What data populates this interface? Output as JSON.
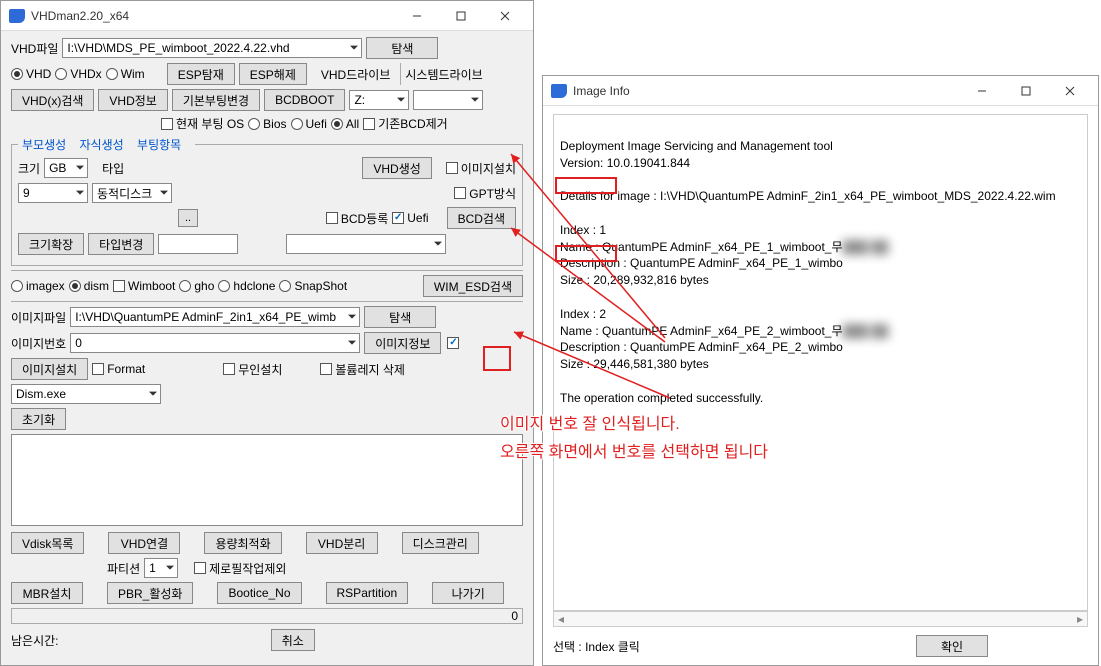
{
  "main": {
    "title": "VHDman2.20_x64",
    "vhd_file_lbl": "VHD파일",
    "vhd_file_path": "I:\\VHD\\MDS_PE_wimboot_2022.4.22.vhd",
    "browse": "탐색",
    "fmt": {
      "vhd": "VHD",
      "vhdx": "VHDx",
      "wim": "Wim"
    },
    "esp_search": "ESP탐재",
    "esp_release": "ESP해제",
    "vhd_drive": "VHD드라이브",
    "sys_drive": "시스템드라이브",
    "vhdx_search": "VHD(x)검색",
    "vhd_info": "VHD정보",
    "basic_boot_change": "기본부팅변경",
    "bcdboot": "BCDBOOT",
    "drive_letter": "Z:",
    "current_boot_os": "현재 부팅 OS",
    "bios": "Bios",
    "uefi": "Uefi",
    "all": "All",
    "remove_existing_bcd": "기존BCD제거",
    "fieldset": {
      "parent": "부모생성",
      "child": "자식생성",
      "boot_items": "부팅항목",
      "size_lbl": "크기",
      "size_unit": "GB",
      "size_val": "9",
      "type_lbl": "타입",
      "type_val": "동적디스크",
      "vhd_create": "VHD생성",
      "img_install": "이미지설치",
      "gpt": "GPT방식",
      "bcd_reg": "BCD등록",
      "uefi": "Uefi",
      "dot_btn": "..",
      "bcd_search": "BCD검색",
      "size_expand": "크기확장",
      "type_change": "타입변경"
    },
    "row_tools": {
      "imagex": "imagex",
      "dism": "dism",
      "wimboot": "Wimboot",
      "gho": "gho",
      "hdclone": "hdclone",
      "snapshot": "SnapShot",
      "wim_esd_search": "WIM_ESD검색"
    },
    "img_file_lbl": "이미지파일",
    "img_file_path": "I:\\VHD\\QuantumPE AdminF_2in1_x64_PE_wimb",
    "img_num_lbl": "이미지번호",
    "img_num_val": "0",
    "img_info_btn": "이미지정보",
    "img_install_btn": "이미지설치",
    "format": "Format",
    "unattend": "무인설치",
    "vol_reg_delete": "볼륨레지 삭제",
    "dism_exe": "Dism.exe",
    "init_btn": "초기화",
    "bottom_btns": {
      "vdisk_list": "Vdisk목록",
      "vhd_connect": "VHD연결",
      "capacity_opt": "용량최적화",
      "vhd_split": "VHD분리",
      "disk_manage": "디스크관리",
      "mbr_install": "MBR설치",
      "pbr_activate": "PBR_활성화",
      "bootice_no": "Bootice_No",
      "rspartition": "RSPartition",
      "exit": "나가기"
    },
    "partition_lbl": "파티션",
    "partition_val": "1",
    "zerofill_exclude": "제로필작업제외",
    "progress_val": "0",
    "remaining_lbl": "남은시간:",
    "cancel": "취소"
  },
  "info": {
    "title": "Image Info",
    "body_line1": "Deployment Image Servicing and Management tool",
    "body_line2": "Version: 10.0.19041.844",
    "body_line3": "Details for image : I:\\VHD\\QuantumPE AdminF_2in1_x64_PE_wimboot_MDS_2022.4.22.wim",
    "idx1": "Index : 1",
    "idx1_name": "Name : QuantumPE AdminF_x64_PE_1_wimboot_무",
    "idx1_desc": "Description : QuantumPE AdminF_x64_PE_1_wimbo",
    "idx1_size": "Size : 20,289,932,816 bytes",
    "idx2": "Index : 2",
    "idx2_name": "Name : QuantumPE AdminF_x64_PE_2_wimboot_무",
    "idx2_desc": "Description : QuantumPE AdminF_x64_PE_2_wimbo",
    "idx2_size": "Size : 29,446,581,380 bytes",
    "done": "The operation completed successfully.",
    "select_lbl": "선택 : Index 클릭",
    "ok": "확인"
  },
  "annot": {
    "line1": "이미지 번호 잘 인식됩니다.",
    "line2": "오른쪽 화면에서 번호를 선택하면 됩니다"
  }
}
